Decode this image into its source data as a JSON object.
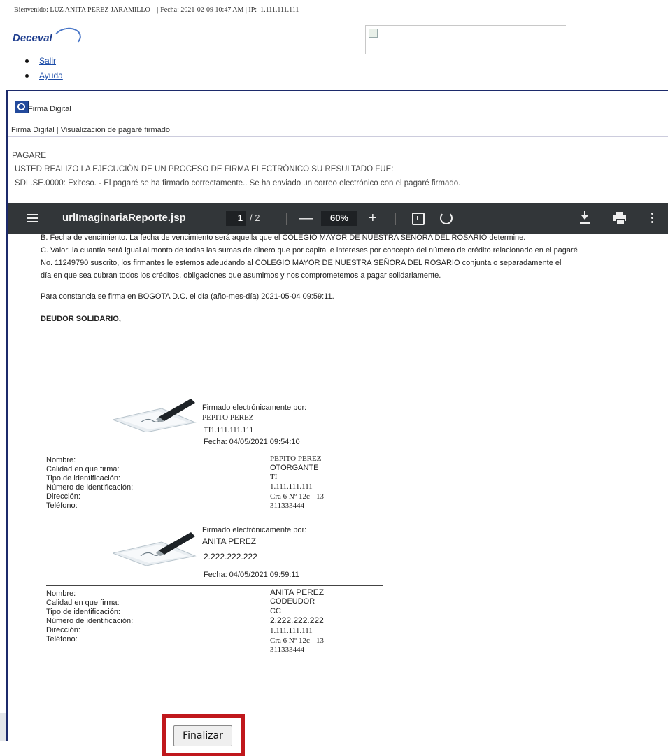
{
  "header": {
    "welcome": "Bienvenido: LUZ ANITA PEREZ JARAMILLO    | Fecha: 2021-02-09 10:47 AM | IP:  1.111.111.111",
    "logo_text": "Deceval"
  },
  "links": [
    {
      "label": "Salir"
    },
    {
      "label": "Ayuda"
    }
  ],
  "panel": {
    "title": "Firma Digital",
    "breadcrumb": "Firma Digital | Visualización de pagaré firmado",
    "section_title": "PAGARE",
    "message_line1": "USTED REALIZO LA EJECUCIÓN DE UN PROCESO DE FIRMA ELECTRÓNICO SU RESULTADO FUE:",
    "message_line2": "SDL.SE.0000: Exitoso. - El pagaré se ha firmado correctamente.. Se ha enviado un correo electrónico con el pagaré firmado."
  },
  "viewer": {
    "file_name": "urlImaginariaReporte.jsp",
    "page_current": "1",
    "page_total": "/ 2",
    "zoom": "60%",
    "zoom_minus": "—",
    "zoom_plus": "+"
  },
  "document": {
    "line_b": "B. Fecha de vencimiento. La fecha de vencimiento será aquella que el COLEGIO MAYOR DE NUESTRA SEÑORA DEL ROSARIO determine.",
    "line_c1": "C. Valor: la cuantía será igual al monto de todas las sumas de dinero que por capital e intereses por concepto del número de crédito relacionado en el pagaré",
    "line_c2": "No. 11249790 suscrito, los firmantes le estemos adeudando al COLEGIO MAYOR DE NUESTRA SEÑORA DEL ROSARIO conjunta o separadamente el",
    "line_c3": "día en que sea cubran todos los créditos, obligaciones que asumimos y nos comprometemos a pagar solidariamente.",
    "constancia": "Para constancia se firma en BOGOTA D.C. el día (año-mes-día) 2021-05-04 09:59:11.",
    "deudor": "DEUDOR SOLIDARIO,",
    "signers": [
      {
        "signed_by": "Firmado electrónicamente por:",
        "name": "PEPITO PEREZ",
        "id": "TI1.111.111.111",
        "date": "Fecha: 04/05/2021 09:54:10",
        "fields": [
          {
            "label": "Nombre:",
            "value": "PEPITO PEREZ"
          },
          {
            "label": "Calidad en que firma:",
            "value": "OTORGANTE"
          },
          {
            "label": "Tipo de identificación:",
            "value": "TI"
          },
          {
            "label": "Número de identificación:",
            "value": "1.111.111.111"
          },
          {
            "label": "Dirección:",
            "value": "Cra 6 Nº 12c - 13"
          },
          {
            "label": "Teléfono:",
            "value": "311333444"
          }
        ]
      },
      {
        "signed_by": "Firmado electrónicamente por:",
        "name": "ANITA PEREZ",
        "id": "2.222.222.222",
        "date": "Fecha: 04/05/2021 09:59:11",
        "fields": [
          {
            "label": "Nombre:",
            "value": "ANITA PEREZ"
          },
          {
            "label": "Calidad en que firma:",
            "value": "CODEUDOR"
          },
          {
            "label": "Tipo de identificación:",
            "value": "CC"
          },
          {
            "label": "Número de identificación:",
            "value": "2.222.222.222"
          },
          {
            "label": "Dirección:",
            "value": "1.111.111.111"
          },
          {
            "label": "Teléfono:",
            "value": "Cra 6 Nº 12c - 13"
          },
          {
            "label": "",
            "value": "311333444"
          }
        ]
      }
    ]
  },
  "actions": {
    "finish_label": "Finalizar"
  },
  "colors": {
    "toolbar_bg": "#323639",
    "frame_border": "#1c2a6b",
    "link": "#1a4ba8",
    "highlight": "#c0171c"
  }
}
